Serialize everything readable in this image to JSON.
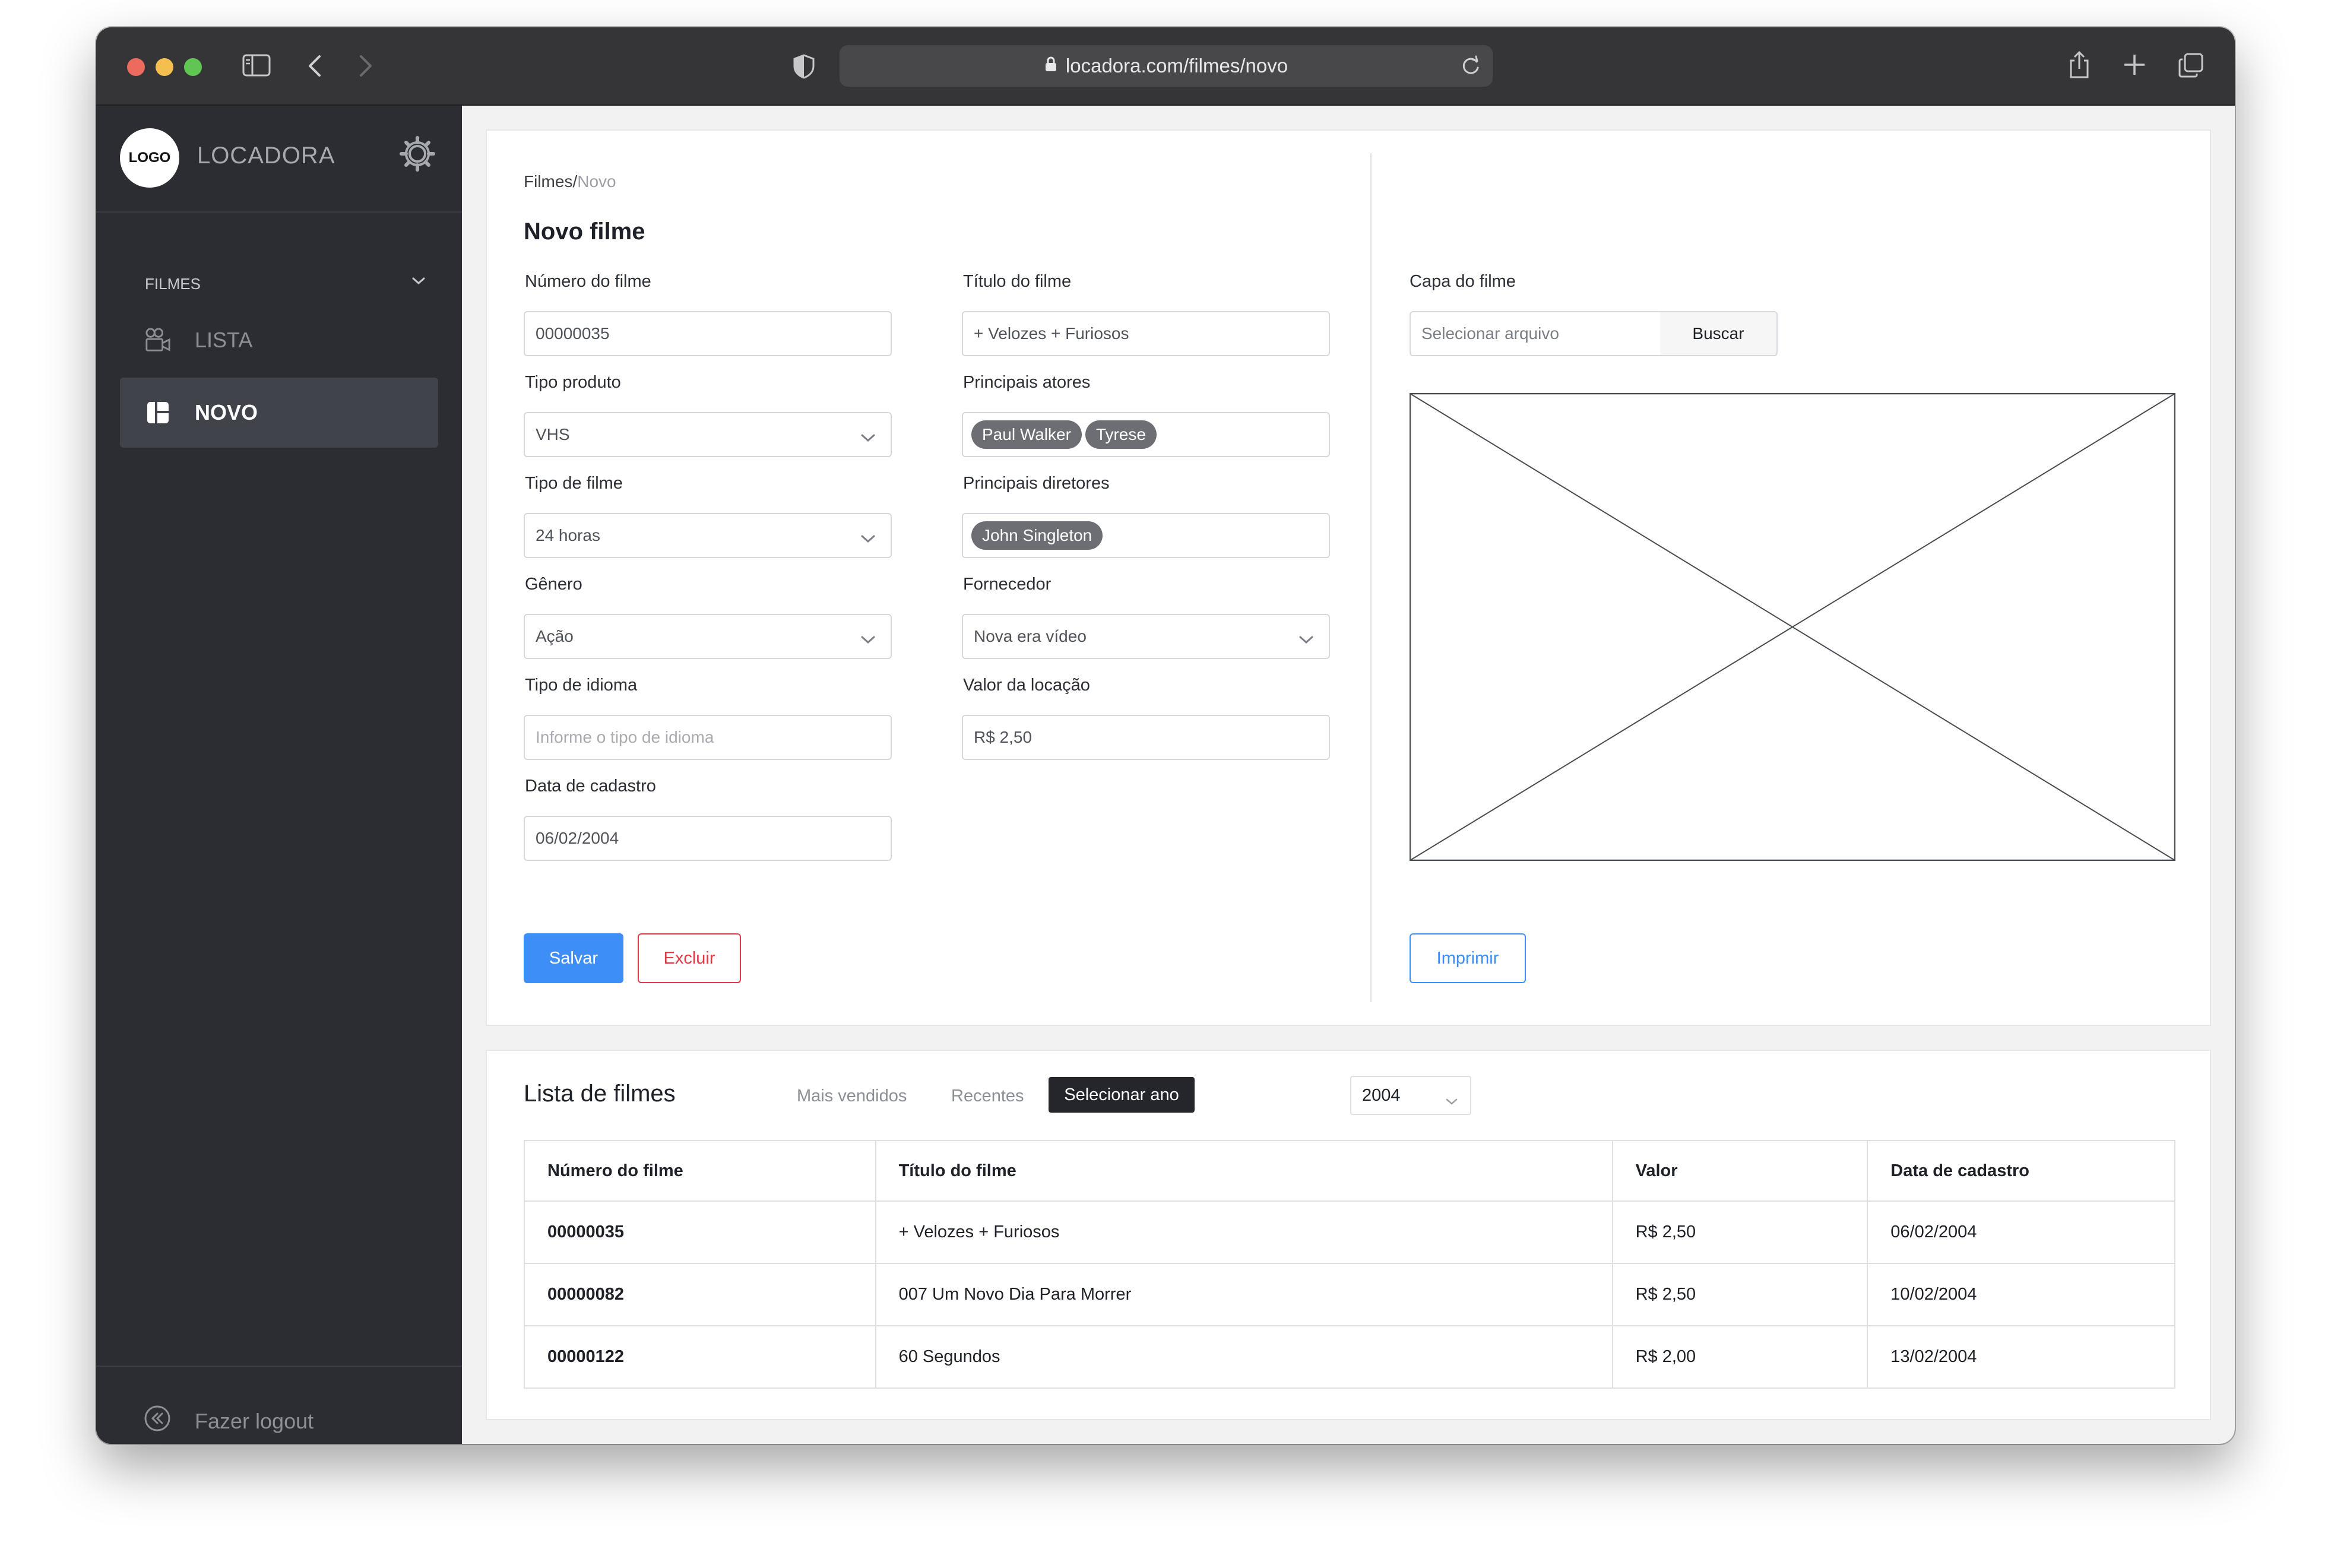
{
  "browser": {
    "url": "locadora.com/filmes/novo"
  },
  "sidebar": {
    "logo_text": "LOGO",
    "brand": "LOCADORA",
    "section": "FILMES",
    "items": [
      {
        "label": "LISTA",
        "active": false
      },
      {
        "label": "NOVO",
        "active": true
      }
    ],
    "logout": "Fazer logout"
  },
  "form": {
    "breadcrumb": {
      "parent": "Filmes",
      "separator": "/",
      "current": "Novo"
    },
    "title": "Novo filme",
    "numero": {
      "label": "Número do filme",
      "value": "00000035"
    },
    "titulo": {
      "label": "Título do filme",
      "value": "+ Velozes + Furiosos"
    },
    "tipo_produto": {
      "label": "Tipo produto",
      "value": "VHS"
    },
    "atores": {
      "label": "Principais atores",
      "chips": [
        "Paul Walker",
        "Tyrese"
      ]
    },
    "tipo_filme": {
      "label": "Tipo de filme",
      "value": "24 horas"
    },
    "diretores": {
      "label": "Principais diretores",
      "chips": [
        "John Singleton"
      ]
    },
    "genero": {
      "label": "Gênero",
      "value": "Ação"
    },
    "fornecedor": {
      "label": "Fornecedor",
      "value": "Nova era vídeo"
    },
    "idioma": {
      "label": "Tipo de idioma",
      "placeholder": "Informe o tipo de idioma"
    },
    "valor": {
      "label": "Valor da locação",
      "value": "R$ 2,50"
    },
    "data": {
      "label": "Data de cadastro",
      "value": "06/02/2004"
    },
    "capa": {
      "label": "Capa do filme",
      "placeholder": "Selecionar arquivo",
      "button": "Buscar"
    },
    "buttons": {
      "save": "Salvar",
      "delete": "Excluir",
      "print": "Imprimir"
    }
  },
  "list": {
    "title": "Lista de filmes",
    "filters": [
      "Mais vendidos",
      "Recentes",
      "Selecionar ano"
    ],
    "year": "2004",
    "columns": [
      "Número do filme",
      "Título do filme",
      "Valor",
      "Data de cadastro"
    ],
    "rows": [
      [
        "00000035",
        "+ Velozes + Furiosos",
        "R$ 2,50",
        "06/02/2004"
      ],
      [
        "00000082",
        "007 Um Novo Dia Para Morrer",
        "R$ 2,50",
        "10/02/2004"
      ],
      [
        "00000122",
        "60 Segundos",
        "R$ 2,00",
        "13/02/2004"
      ]
    ]
  },
  "colors": {
    "sidebar_bg": "#2b2d33",
    "primary": "#3e8ef7",
    "danger": "#e03a47",
    "chip": "#6c6e73"
  }
}
